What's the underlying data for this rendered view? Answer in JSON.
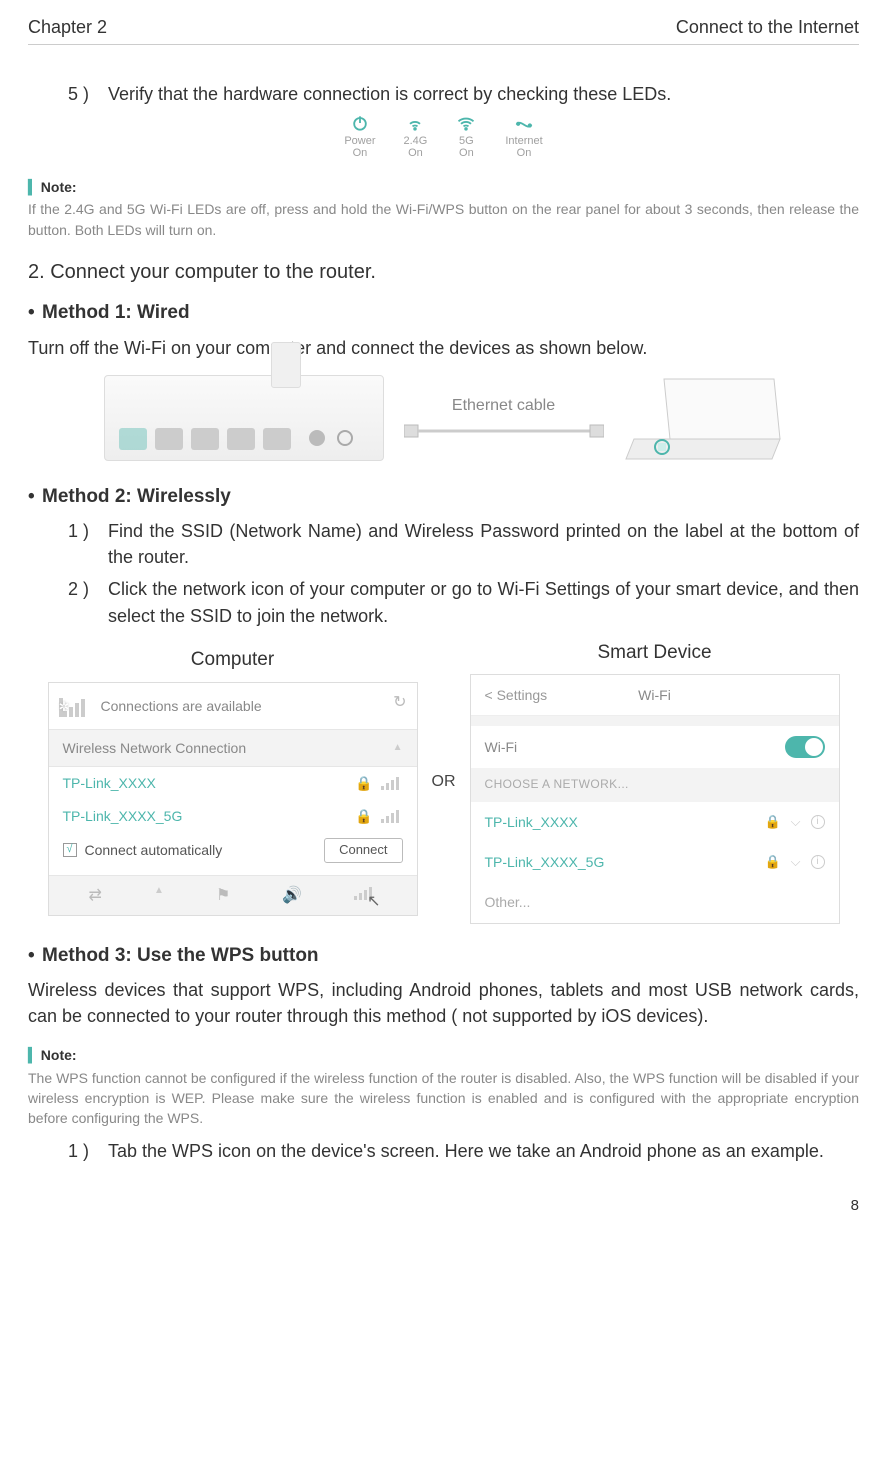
{
  "header": {
    "left": "Chapter 2",
    "right": "Connect to the Internet"
  },
  "step5": {
    "no": "5 )",
    "text": "Verify that the hardware connection is correct by checking these LEDs."
  },
  "leds": {
    "power": {
      "label": "Power",
      "state": "On"
    },
    "g24": {
      "label": "2.4G",
      "state": "On"
    },
    "g5": {
      "label": "5G",
      "state": "On"
    },
    "inet": {
      "label": "Internet",
      "state": "On"
    }
  },
  "note1": {
    "label": "Note:",
    "text": "If the 2.4G and 5G Wi-Fi LEDs are off, press and hold the Wi-Fi/WPS button on the rear panel for about 3 seconds, then release the button. Both LEDs will turn on."
  },
  "sec2": "2. Connect your computer to the router.",
  "method1": {
    "title": "Method 1: Wired",
    "text": "Turn off the Wi-Fi on your computer and connect the devices as shown below."
  },
  "cable_label": "Ethernet cable",
  "method2": {
    "title": "Method 2: Wirelessly",
    "s1": {
      "no": "1 )",
      "text": "Find the SSID (Network Name) and Wireless Password printed on the label at the bottom of the router."
    },
    "s2": {
      "no": "2 )",
      "text": "Click the network icon of your computer or go to Wi-Fi Settings of your smart device, and then select the SSID to join the network."
    }
  },
  "panels": {
    "computer": {
      "title": "Computer",
      "avail": "Connections are available",
      "sectionHdr": "Wireless Network Connection",
      "ssid1": "TP-Link_XXXX",
      "ssid2": "TP-Link_XXXX_5G",
      "auto": "Connect automatically",
      "connect": "Connect"
    },
    "or": "OR",
    "phone": {
      "title": "Smart Device",
      "back": "< Settings",
      "hdr": "Wi-Fi",
      "wifiRow": "Wi-Fi",
      "choose": "CHOOSE A NETWORK...",
      "ssid1": "TP-Link_XXXX",
      "ssid2": "TP-Link_XXXX_5G",
      "other": "Other..."
    }
  },
  "method3": {
    "title": "Method 3: Use the WPS button",
    "text": "Wireless devices that support WPS, including Android phones, tablets and most USB network cards, can be connected to your router through this method ( not supported by iOS devices)."
  },
  "note2": {
    "label": "Note:",
    "text": "The WPS function cannot be configured if the wireless function of the router is disabled. Also, the WPS function will be disabled if your wireless encryption is WEP. Please make sure the wireless function is enabled and is configured with the appropriate encryption before configuring the WPS."
  },
  "wps_s1": {
    "no": "1 )",
    "text": "Tab the WPS icon on the device's screen. Here we take an Android phone as an example."
  },
  "page": "8"
}
